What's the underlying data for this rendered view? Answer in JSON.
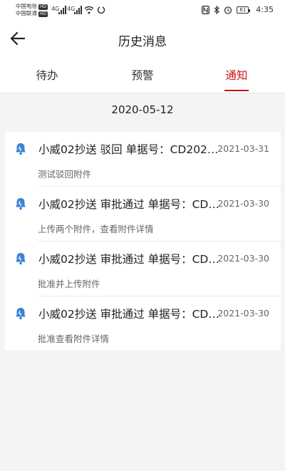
{
  "statusbar": {
    "carrier1": "中国电信",
    "carrier2": "中国联通",
    "hd": "HD",
    "net1": "4G",
    "net2": "4G",
    "battery": "61",
    "time": "4:35"
  },
  "header": {
    "title": "历史消息"
  },
  "tabs": [
    {
      "label": "待办"
    },
    {
      "label": "预警"
    },
    {
      "label": "通知"
    }
  ],
  "active_tab": "通知",
  "date": "2020-05-12",
  "messages": [
    {
      "title": "小威02抄送  驳回 单据号：CD2021…",
      "time": "2021-03-31",
      "desc": "测试驳回附件"
    },
    {
      "title": "小威02抄送  审批通过 单据号：CD…",
      "time": "2021-03-30",
      "desc": "上传两个附件，查看附件详情"
    },
    {
      "title": "小威02抄送  审批通过 单据号：CD…",
      "time": "2021-03-30",
      "desc": "批准并上传附件"
    },
    {
      "title": "小威02抄送  审批通过 单据号：CD…",
      "time": "2021-03-30",
      "desc": "批准查看附件详情"
    }
  ],
  "colors": {
    "accent": "#c8151b",
    "bell": "#3b82d6"
  }
}
